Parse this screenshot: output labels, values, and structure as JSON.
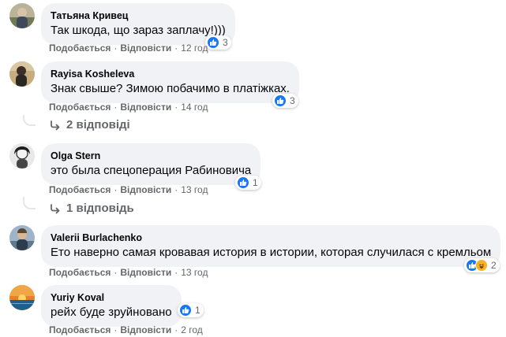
{
  "comments": [
    {
      "author": "Татьяна Кривец",
      "text": "Так шкода, що зараз заплачу!)))",
      "like": "Подобається",
      "reply": "Відповісти",
      "time": "12 год",
      "reactions": "3"
    },
    {
      "author": "Rayisa Kosheleva",
      "text": "Знак свыше? Зимою побачимо в платіжках.",
      "like": "Подобається",
      "reply": "Відповісти",
      "time": "14 год",
      "reactions": "3",
      "replies_label": "2 відповіді"
    },
    {
      "author": "Olga Stern",
      "text": "это была спецоперация Рабиновича",
      "like": "Подобається",
      "reply": "Відповісти",
      "time": "13 год",
      "reactions": "1",
      "replies_label": "1 відповідь"
    },
    {
      "author": "Valerii Burlachenko",
      "text": "Ето наверно самая кровавая история в истории, которая случилася с кремльом",
      "like": "Подобається",
      "reply": "Відповісти",
      "time": "13 год",
      "reactions": "2"
    },
    {
      "author": "Yuriy Koval",
      "text": "рейх буде зруйновано",
      "like": "Подобається",
      "reply": "Відповісти",
      "time": "2 год",
      "reactions": "1"
    }
  ],
  "separator": "·"
}
